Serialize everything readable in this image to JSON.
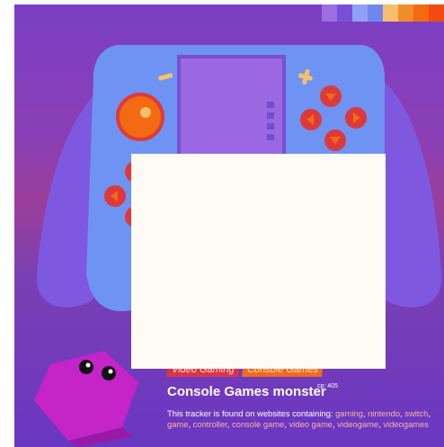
{
  "palette": [
    "#9b6fe0",
    "#7a4fd8",
    "#8fa0f5",
    "#6f86f2",
    "#f6bf6a",
    "#f28c2a",
    "#f26a12",
    "#f24a10"
  ],
  "tags": [
    "Video Gaming",
    "Console Games"
  ],
  "monster": {
    "name": "Console Games monster",
    "cp": "cp: 405",
    "found_text": "This tracker is found on websites containing:",
    "keywords": [
      "gaming",
      "nintendo",
      "switch",
      "game",
      "controller",
      "console game",
      "video game",
      "videogame",
      "videogames"
    ]
  },
  "colors": {
    "controller": "#6f93f2",
    "grip": "#7e59e0",
    "screen": "#9a68e0",
    "button": "#dc3a3a",
    "monster": "#c424c8"
  }
}
